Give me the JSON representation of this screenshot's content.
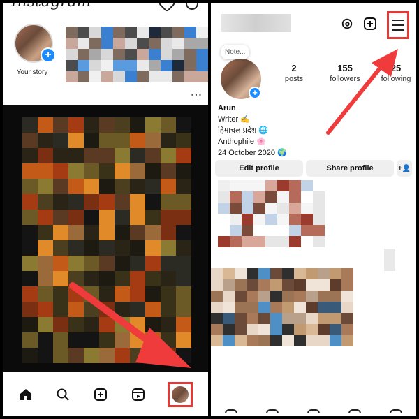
{
  "left": {
    "header": {
      "logo": "Instagram"
    },
    "story": {
      "label": "Your story",
      "add_symbol": "+"
    },
    "post": {
      "more_symbol": "⋮"
    },
    "bottom_nav": {
      "items": [
        {
          "icon": "home-icon"
        },
        {
          "icon": "search-icon"
        },
        {
          "icon": "create-icon"
        },
        {
          "icon": "reels-icon"
        },
        {
          "icon": "profile-avatar-icon",
          "highlighted": true
        }
      ]
    }
  },
  "right": {
    "header": {
      "icons": [
        "threads-icon",
        "create-icon",
        "menu-icon"
      ],
      "menu_highlighted": true
    },
    "note": "Note...",
    "add_symbol": "+",
    "stats": [
      {
        "value": "2",
        "label": "posts"
      },
      {
        "value": "155",
        "label": "followers"
      },
      {
        "value": "25",
        "label": "following"
      }
    ],
    "bio": {
      "name": "Arun",
      "line1": "Writer ✍️",
      "line2": "हिमाचल प्रदेश 🌐",
      "line3": "Anthophile 🌸",
      "line4": "24 October 2020 🌍"
    },
    "buttons": {
      "edit_profile": "Edit profile",
      "share_profile": "Share profile",
      "add_person": "+👤"
    }
  },
  "colors": {
    "highlight": "#e53935",
    "accent_blue": "#1a8cff"
  }
}
